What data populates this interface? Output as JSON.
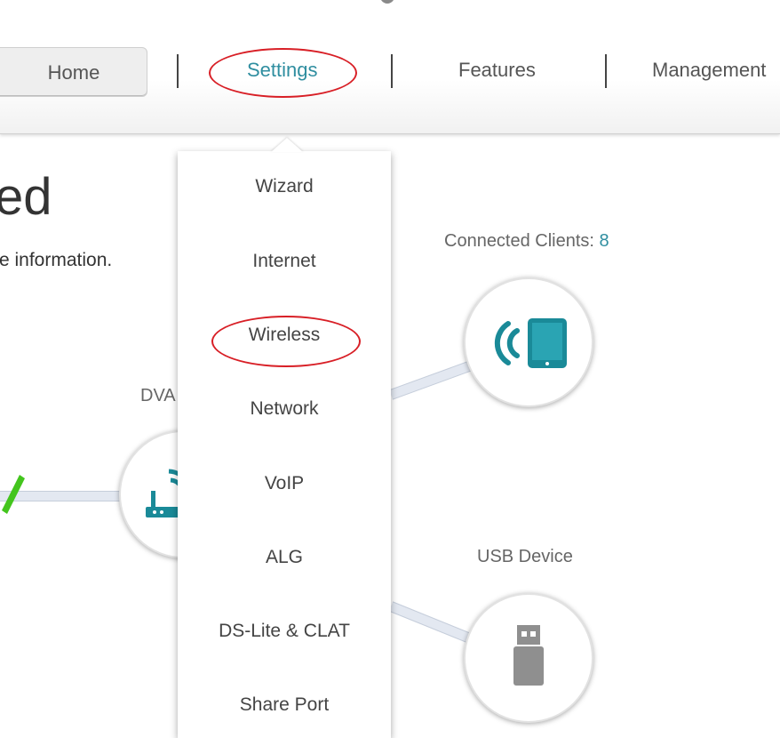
{
  "nav": {
    "home": "Home",
    "settings": "Settings",
    "features": "Features",
    "management": "Management"
  },
  "hero": {
    "title_fragment": "ed",
    "subtitle_fragment": "re information."
  },
  "diagram": {
    "device_label_fragment": "DVA",
    "connected_clients_label": "Connected Clients:",
    "connected_clients_count": "8",
    "usb_device_label": "USB Device"
  },
  "settings_menu": {
    "items": [
      "Wizard",
      "Internet",
      "Wireless",
      "Network",
      "VoIP",
      "ALG",
      "DS-Lite & CLAT",
      "Share Port"
    ],
    "highlighted": "Wireless"
  },
  "colors": {
    "accent_teal": "#2f8ea0",
    "annotation_red": "#d81f26",
    "status_green": "#43c51d",
    "usb_gray": "#8f8f8f"
  },
  "icons": {
    "router": "router-icon",
    "client": "wireless-tablet-icon",
    "usb": "usb-drive-icon",
    "status": "checkmark-icon"
  }
}
